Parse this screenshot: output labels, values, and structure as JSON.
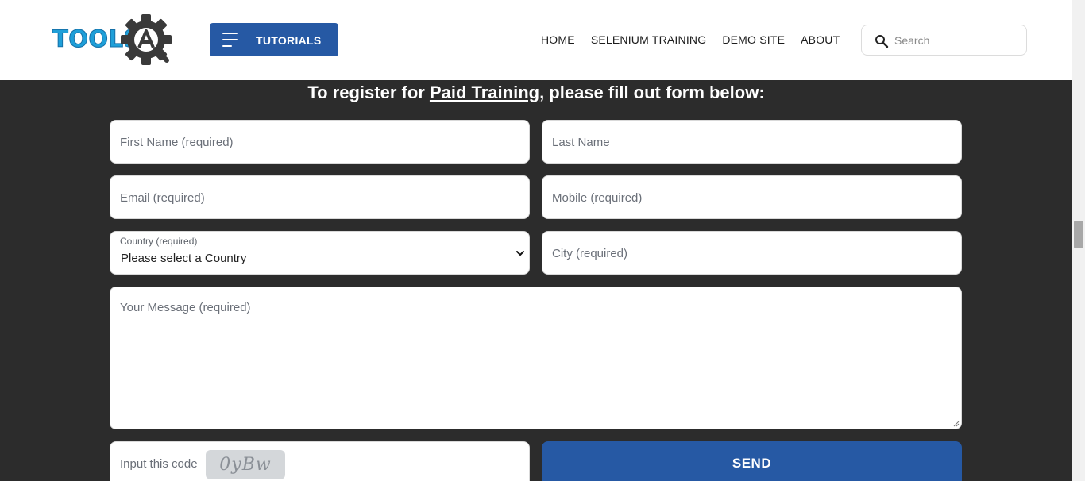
{
  "header": {
    "logo_text": "TOOLS",
    "logo_letter": "A",
    "tutorials_label": "TUTORIALS",
    "nav": [
      "HOME",
      "SELENIUM TRAINING",
      "DEMO SITE",
      "ABOUT"
    ],
    "search_placeholder": "Search"
  },
  "form": {
    "heading_prefix": "To register for ",
    "heading_link": "Paid Training",
    "heading_suffix": ", please fill out form below:",
    "first_name_placeholder": "First Name (required)",
    "last_name_placeholder": "Last Name",
    "email_placeholder": "Email (required)",
    "mobile_placeholder": "Mobile (required)",
    "country_label": "Country (required)",
    "country_value": "Please select a Country",
    "city_placeholder": "City (required)",
    "message_placeholder": "Your Message (required)",
    "captcha_label": "Input this code",
    "captcha_code": "0yBw",
    "send_label": "SEND"
  },
  "colors": {
    "brand_blue": "#2659a4",
    "dark_bg": "#2c2c2c",
    "logo_cyan": "#1f9fd8"
  }
}
